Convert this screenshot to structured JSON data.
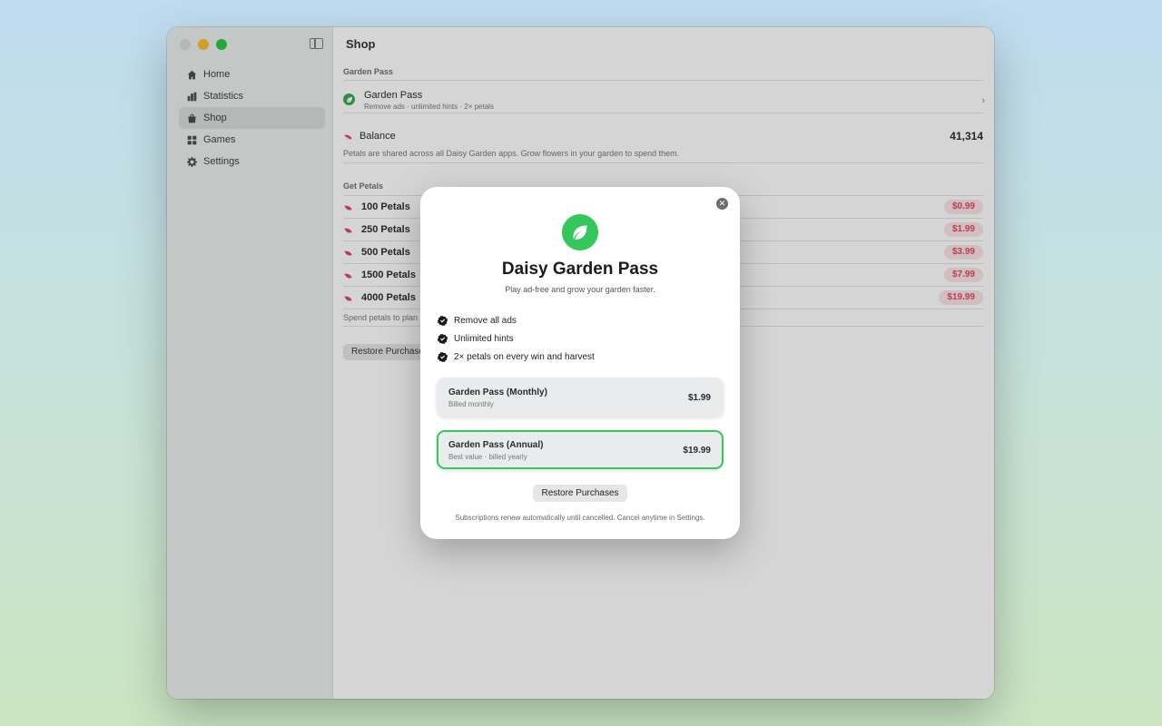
{
  "window": {
    "title": "Shop"
  },
  "sidebar": {
    "items": [
      {
        "label": "Home",
        "icon": "house-icon",
        "active": false
      },
      {
        "label": "Statistics",
        "icon": "bar-chart-icon",
        "active": false
      },
      {
        "label": "Shop",
        "icon": "shopping-bag-icon",
        "active": true
      },
      {
        "label": "Games",
        "icon": "grid-icon",
        "active": false
      },
      {
        "label": "Settings",
        "icon": "gear-icon",
        "active": false
      }
    ]
  },
  "shop": {
    "garden_pass_section": "Garden Pass",
    "garden_pass": {
      "name": "Garden Pass",
      "subtitle": "Remove ads · unlimited hints · 2× petals"
    },
    "balance": {
      "label": "Balance",
      "value": "41,314",
      "note": "Petals are shared across all Daisy Garden apps. Grow flowers in your garden to spend them."
    },
    "get_petals_section": "Get Petals",
    "petal_packs": [
      {
        "name": "100 Petals",
        "price": "$0.99"
      },
      {
        "name": "250 Petals",
        "price": "$1.99"
      },
      {
        "name": "500 Petals",
        "price": "$3.99"
      },
      {
        "name": "1500 Petals",
        "price": "$7.99"
      },
      {
        "name": "4000 Petals",
        "price": "$19.99"
      }
    ],
    "spend_note": "Spend petals to plan",
    "restore_label": "Restore Purchase"
  },
  "modal": {
    "title": "Daisy Garden Pass",
    "subtitle": "Play ad-free and grow your garden faster.",
    "close_label": "✕",
    "features": [
      "Remove all ads",
      "Unlimited hints",
      "2× petals on every win and harvest"
    ],
    "plans": [
      {
        "name": "Garden Pass (Monthly)",
        "sub": "Billed monthly",
        "price": "$1.99",
        "selected": false
      },
      {
        "name": "Garden Pass (Annual)",
        "sub": "Best value · billed yearly",
        "price": "$19.99",
        "selected": true
      }
    ],
    "restore_label": "Restore Purchases",
    "footnote": "Subscriptions renew automatically until cancelled. Cancel anytime in Settings."
  },
  "colors": {
    "accent_green": "#34c759",
    "petal_pink": "#e0475d"
  }
}
